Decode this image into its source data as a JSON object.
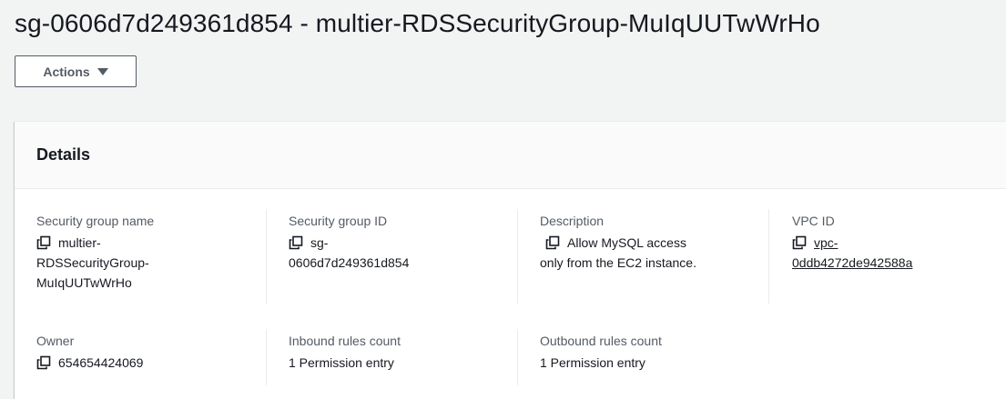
{
  "page_title": "sg-0606d7d249361d854 - multier-RDSSecurityGroup-MuIqUUTwWrHo",
  "actions_label": "Actions",
  "details": {
    "heading": "Details",
    "security_group_name": {
      "label": "Security group name",
      "value_line1": "multier-",
      "value_line2": "RDSSecurityGroup-",
      "value_line3": "MuIqUUTwWrHo"
    },
    "security_group_id": {
      "label": "Security group ID",
      "value_line1": "sg-",
      "value_line2": "0606d7d249361d854"
    },
    "description": {
      "label": "Description",
      "value_line1": "Allow MySQL access",
      "value_line2": "only from the EC2 instance."
    },
    "vpc_id": {
      "label": "VPC ID",
      "value_line1": "vpc-",
      "value_line2": "0ddb4272de942588a"
    },
    "owner": {
      "label": "Owner",
      "value": "654654424069"
    },
    "inbound_rules_count": {
      "label": "Inbound rules count",
      "value": "1 Permission entry"
    },
    "outbound_rules_count": {
      "label": "Outbound rules count",
      "value": "1 Permission entry"
    }
  },
  "colors": {
    "link": "#0073bb",
    "label": "#545b64",
    "text": "#16191f",
    "background": "#f2f3f3"
  },
  "icons": {
    "copy": "copy-icon",
    "dropdown": "caret-down-icon"
  }
}
